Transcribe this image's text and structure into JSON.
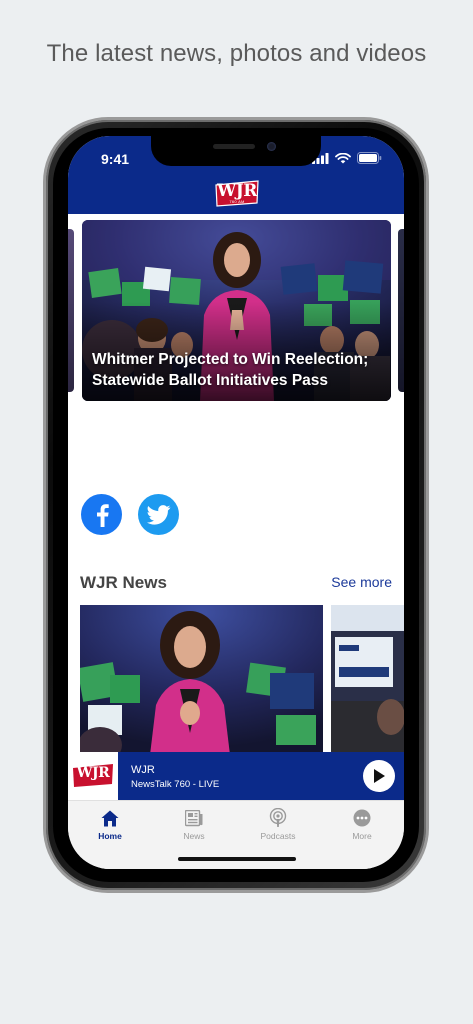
{
  "headline": "The latest news, photos and videos",
  "status_bar": {
    "time": "9:41"
  },
  "header": {
    "logo_text": "WJR",
    "logo_subtext": "760 AM",
    "brand_color": "#0b2a8a",
    "logo_red": "#c8102e"
  },
  "hero": {
    "caption": "Whitmer Projected to Win Reelection; Statewide Ballot Initiatives Pass"
  },
  "social": {
    "facebook_color": "#1877f2",
    "twitter_color": "#1d9bf0"
  },
  "news_section": {
    "title": "WJR News",
    "see_more": "See more"
  },
  "player": {
    "station": "WJR",
    "stream": "NewsTalk 760 - LIVE"
  },
  "tabs": [
    {
      "label": "Home",
      "icon": "home-icon",
      "active": true
    },
    {
      "label": "News",
      "icon": "news-icon",
      "active": false
    },
    {
      "label": "Podcasts",
      "icon": "podcasts-icon",
      "active": false
    },
    {
      "label": "More",
      "icon": "more-icon",
      "active": false
    }
  ]
}
